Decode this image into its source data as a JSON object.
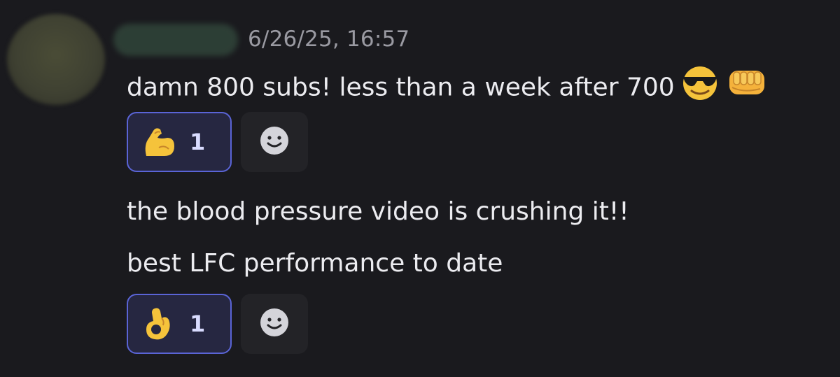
{
  "message": {
    "timestamp": "6/26/25, 16:57",
    "lines": [
      "damn 800 subs! less than a week after 700",
      "the blood pressure video is crushing it!!",
      "best LFC performance to date"
    ],
    "inline_emojis": [
      "smiling-face-with-sunglasses",
      "oncoming-fist"
    ]
  },
  "reactions": [
    {
      "emoji": "flexed-biceps",
      "count": "1"
    },
    {
      "emoji": "ok-hand",
      "count": "1"
    }
  ],
  "add_reaction_icon": "smiley-add-reaction-icon",
  "colors": {
    "background": "#1a1a1e",
    "reaction_border": "#5a64d6",
    "reaction_bg": "#262741",
    "emoji_yellow": "#f5c33b"
  }
}
